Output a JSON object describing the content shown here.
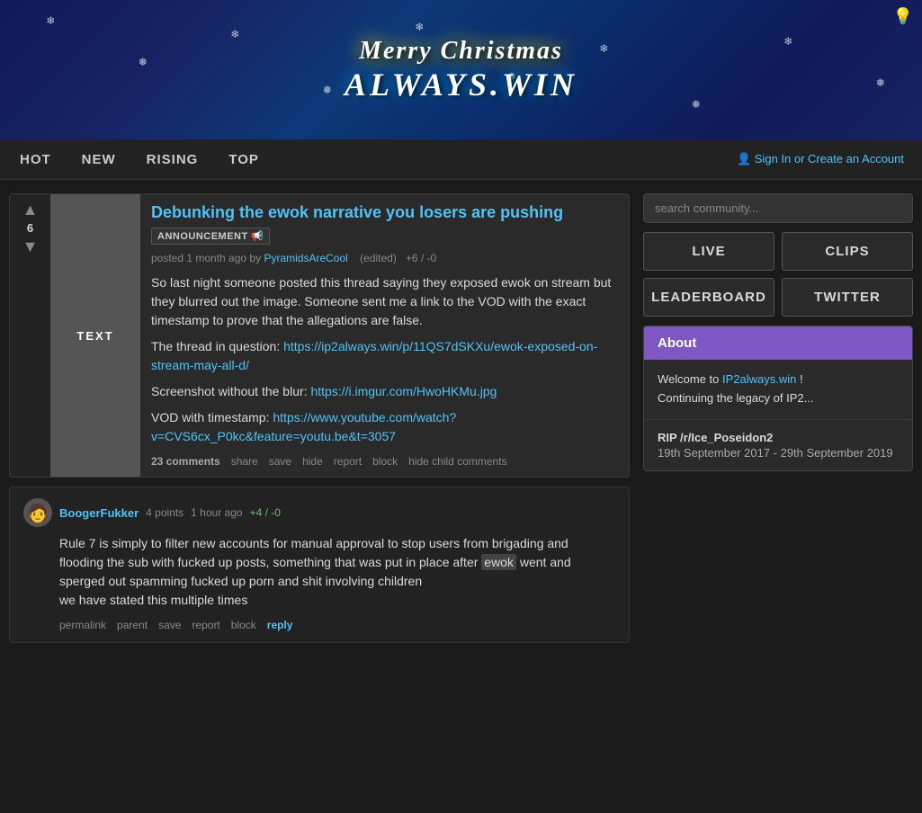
{
  "banner": {
    "christmas_text": "Merry Christmas",
    "site_name": "ALWAYS.WIN"
  },
  "navbar": {
    "links": [
      {
        "label": "HOT",
        "id": "hot"
      },
      {
        "label": "NEW",
        "id": "new"
      },
      {
        "label": "RISING",
        "id": "rising"
      },
      {
        "label": "TOP",
        "id": "top"
      }
    ],
    "auth_text": "Sign In or Create an Account"
  },
  "post": {
    "vote_count": "6",
    "thumbnail_label": "TEXT",
    "title": "Debunking the ewok narrative you losers are pushing",
    "tag": "ANNOUNCEMENT 📢",
    "meta_posted": "posted 1 month ago by",
    "meta_author": "PyramidsAreCool",
    "meta_edited": "(edited)",
    "meta_score": "+6 / -0",
    "content_lines": [
      "So last night someone posted this thread saying they exposed ewok on stream but they blurred out the image. Someone sent me a link to the VOD with the exact timestamp to prove that the allegations are false.",
      "The thread in question:",
      "https://ip2always.win/p/11QS7dSKXu/ewok-exposed-on-stream-may-all-d/",
      "Screenshot without the blur:",
      "https://i.imgur.com/HwoHKMu.jpg",
      "VOD with timestamp:",
      "https://www.youtube.com/watch?v=CVS6cx_P0kc&feature=youtu.be&t=3057"
    ],
    "link_thread": "https://ip2always.win/p/11QS7dSKXu/ewok-exposed-on-stream-may-all-d/",
    "link_screenshot": "https://i.imgur.com/HwoHKMu.jpg",
    "link_vod": "https://www.youtube.com/watch?v=CVS6cx_P0kc&feature=youtu.be&t=3057",
    "comments_label": "23 comments",
    "actions": [
      "share",
      "save",
      "hide",
      "report",
      "block",
      "hide child comments"
    ]
  },
  "comment": {
    "username": "BoogerFukker",
    "points": "4 points",
    "time": "1 hour ago",
    "score_change": "+4 / -0",
    "body_part1": "Rule 7 is simply to filter new accounts for manual approval to stop users from brigading and flooding the sub with fucked up posts, something that was put in place after",
    "highlight_word": "ewok",
    "body_part2": "went and sperged out spamming fucked up porn and shit involving children",
    "body_line2": "we have stated this multiple times",
    "actions": [
      "permalink",
      "parent",
      "save",
      "report",
      "block",
      "reply"
    ]
  },
  "sidebar": {
    "search_placeholder": "search community...",
    "buttons": [
      {
        "label": "LIVE",
        "id": "live"
      },
      {
        "label": "CLIPS",
        "id": "clips"
      },
      {
        "label": "LEADERBOARD",
        "id": "leaderboard"
      },
      {
        "label": "TWITTER",
        "id": "twitter"
      }
    ],
    "about_header": "About",
    "welcome_text": "Welcome to",
    "site_link": "IP2always.win",
    "welcome_cont": "!",
    "legacy_text": "Continuing the legacy of IP2...",
    "rip_title": "RIP /r/Ice_Poseidon2",
    "rip_dates": "19th September 2017 - 29th September 2019"
  }
}
